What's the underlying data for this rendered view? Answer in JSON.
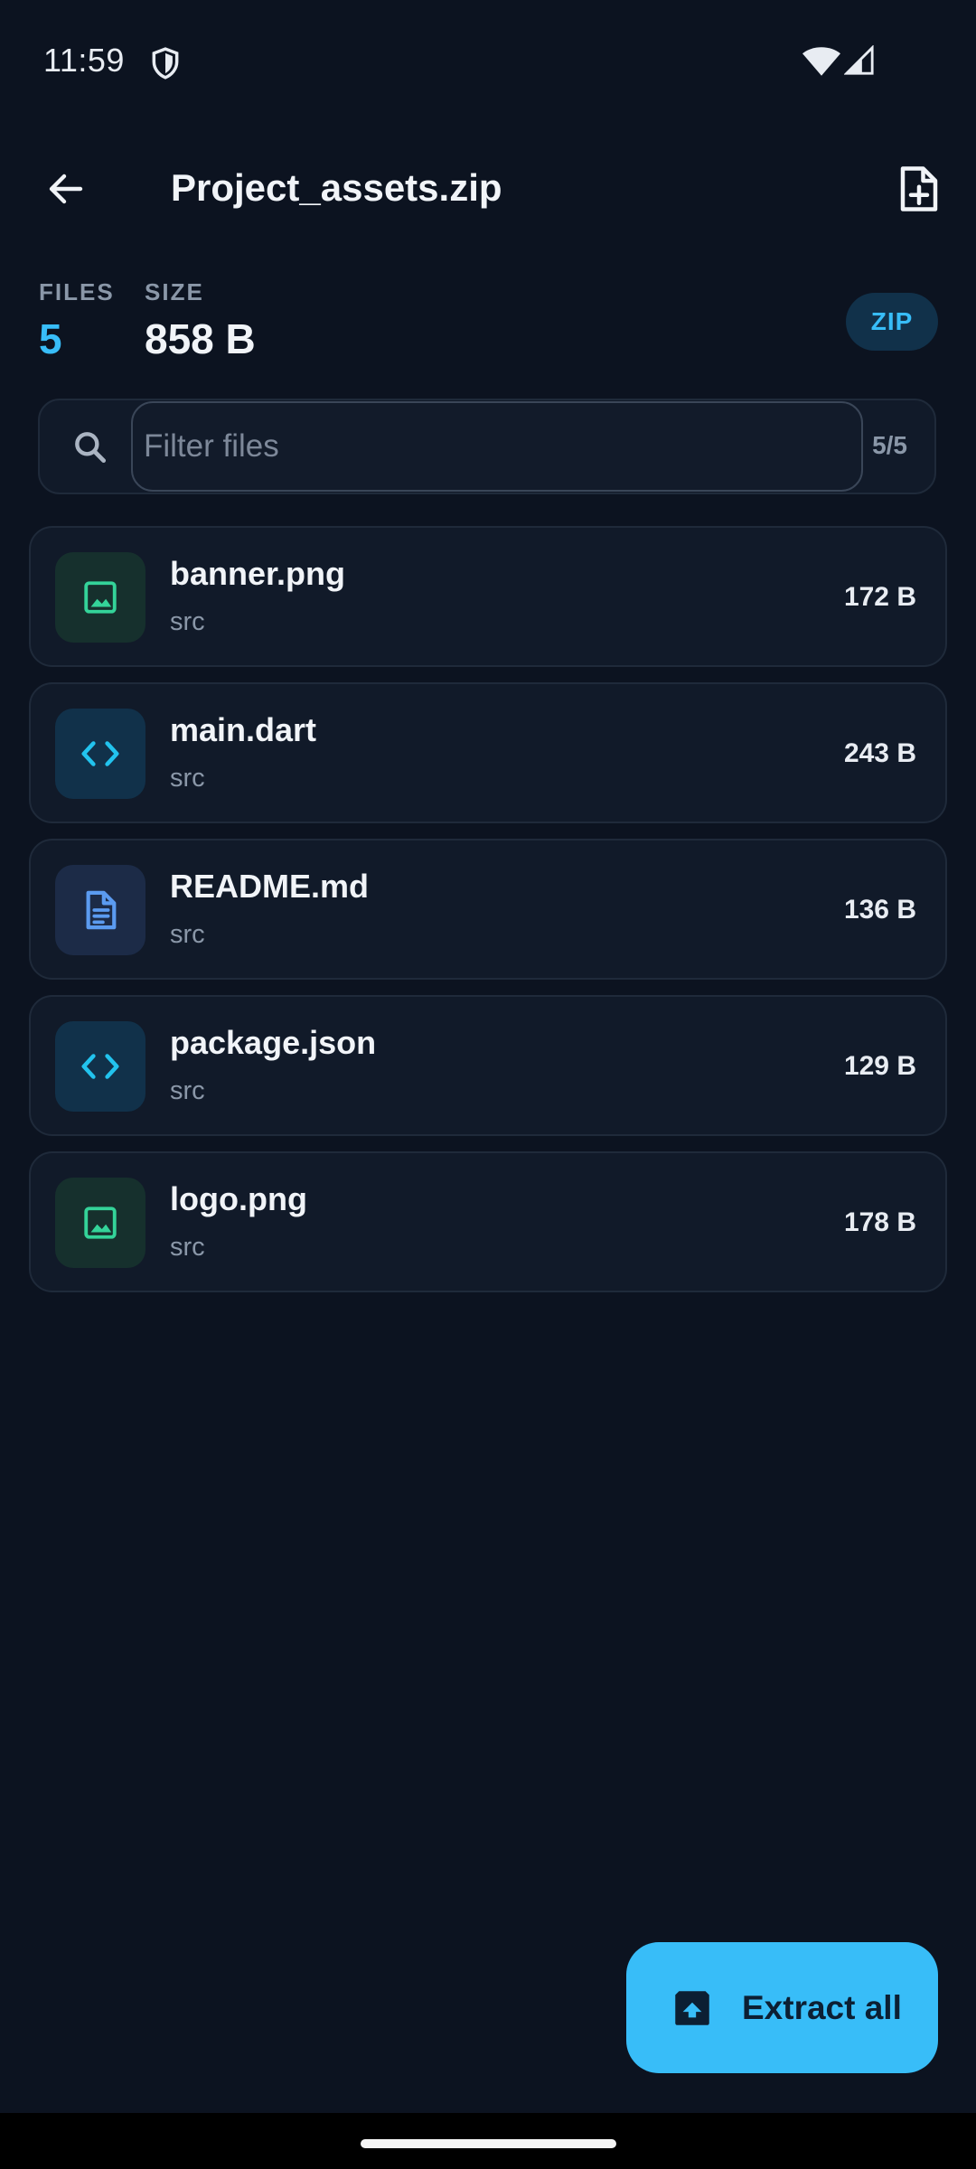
{
  "status_bar": {
    "time": "11:59",
    "icons": [
      "shield-icon",
      "wifi-icon",
      "signal-icon"
    ]
  },
  "appbar": {
    "title": "Project_assets.zip",
    "back_icon": "arrow-left-icon",
    "action_icon": "new-file-icon"
  },
  "stats": {
    "files_label": "FILES",
    "files_value": "5",
    "size_label": "SIZE",
    "size_value": "858 B",
    "badge": "ZIP"
  },
  "search": {
    "placeholder": "Filter files",
    "value": "",
    "count": "5/5"
  },
  "files": [
    {
      "name": "banner.png",
      "path": "src",
      "size": "172 B",
      "icon": "image-icon",
      "color": "#34d399",
      "icon_bg": "#16302d"
    },
    {
      "name": "main.dart",
      "path": "src",
      "size": "243 B",
      "icon": "code-icon",
      "color": "#22c3ee",
      "icon_bg": "#11314a"
    },
    {
      "name": "README.md",
      "path": "src",
      "size": "136 B",
      "icon": "document-icon",
      "color": "#5b9bf0",
      "icon_bg": "#1c2b47"
    },
    {
      "name": "package.json",
      "path": "src",
      "size": "129 B",
      "icon": "code-icon",
      "color": "#22c3ee",
      "icon_bg": "#11314a"
    },
    {
      "name": "logo.png",
      "path": "src",
      "size": "178 B",
      "icon": "image-icon",
      "color": "#34d399",
      "icon_bg": "#16302d"
    }
  ],
  "fab": {
    "label": "Extract all",
    "icon": "unarchive-icon"
  },
  "colors": {
    "accent": "#38bdf8",
    "background": "#0c1320",
    "surface": "#111a29"
  }
}
